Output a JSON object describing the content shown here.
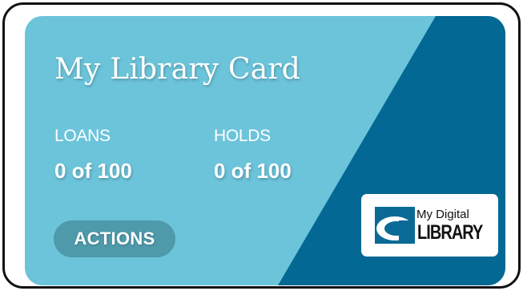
{
  "card": {
    "title": "My Library Card",
    "loans": {
      "label": "LOANS",
      "value": "0 of 100"
    },
    "holds": {
      "label": "HOLDS",
      "value": "0 of 100"
    },
    "actions_label": "ACTIONS",
    "logo": {
      "line1": "My Digital",
      "line2": "LIBRARY"
    }
  },
  "colors": {
    "card_light": "#6cc4da",
    "card_dark": "#036893",
    "actions_button": "#4e99aa",
    "border": "#111111"
  }
}
